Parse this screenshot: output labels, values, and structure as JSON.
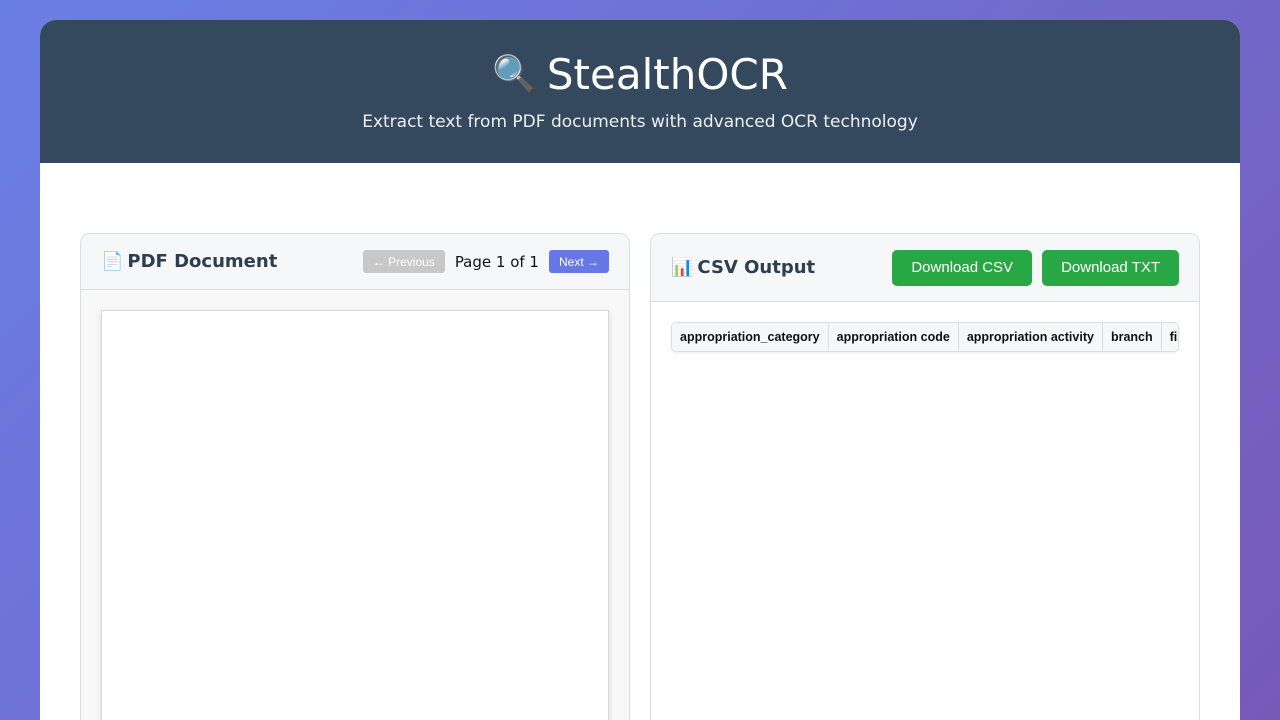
{
  "header": {
    "icon": "magnifier-icon",
    "title": "StealthOCR",
    "subtitle": "Extract text from PDF documents with advanced OCR technology"
  },
  "pdf_panel": {
    "icon": "document-icon",
    "title": "PDF Document",
    "prev_label": "← Previous",
    "next_label": "Next →",
    "page_indicator": "Page 1 of 1"
  },
  "csv_panel": {
    "icon": "bar-chart-icon",
    "title": "CSV Output",
    "download_csv_label": "Download CSV",
    "download_txt_label": "Download TXT",
    "columns": [
      "appropriation_category",
      "appropriation code",
      "appropriation activity",
      "branch",
      "fiscal_year"
    ]
  },
  "colors": {
    "header_bg": "#34495e",
    "accent": "#6778e6",
    "download": "#28a745"
  }
}
